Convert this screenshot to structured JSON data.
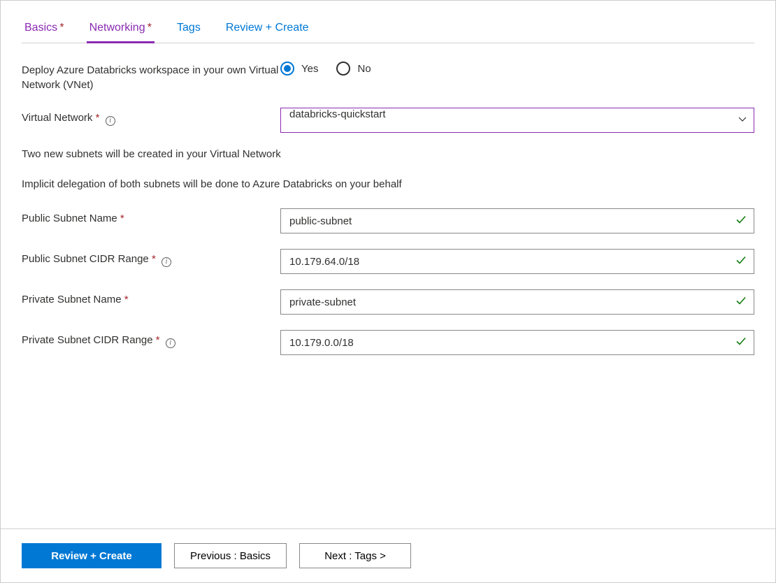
{
  "tabs": [
    {
      "label": "Basics",
      "completed": true,
      "active": false
    },
    {
      "label": "Networking",
      "completed": true,
      "active": true
    },
    {
      "label": "Tags",
      "completed": false,
      "active": false
    },
    {
      "label": "Review + Create",
      "completed": false,
      "active": false
    }
  ],
  "form": {
    "vnetDeployLabel": "Deploy Azure Databricks workspace in your own Virtual Network (VNet)",
    "vnetDeployYes": "Yes",
    "vnetDeployNo": "No",
    "virtualNetworkLabel": "Virtual Network",
    "virtualNetworkValue": "databricks-quickstart",
    "subnetInfo1": "Two new subnets will be created in your Virtual Network",
    "subnetInfo2": "Implicit delegation of both subnets will be done to Azure Databricks on your behalf",
    "publicSubnetNameLabel": "Public Subnet Name",
    "publicSubnetNameValue": "public-subnet",
    "publicSubnetCidrLabel": "Public Subnet CIDR Range",
    "publicSubnetCidrValue": "10.179.64.0/18",
    "privateSubnetNameLabel": "Private Subnet Name",
    "privateSubnetNameValue": "private-subnet",
    "privateSubnetCidrLabel": "Private Subnet CIDR Range",
    "privateSubnetCidrValue": "10.179.0.0/18"
  },
  "footer": {
    "primary": "Review + Create",
    "previous": "Previous : Basics",
    "next": "Next : Tags >"
  }
}
